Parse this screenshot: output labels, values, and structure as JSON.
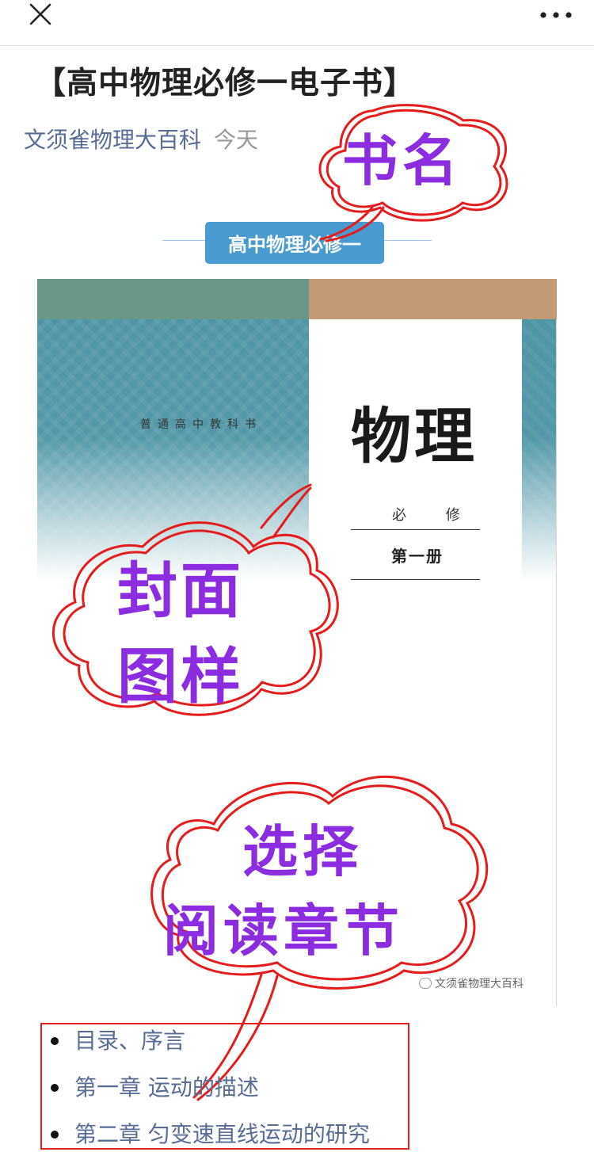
{
  "topbar": {
    "close_icon": "close-icon",
    "more_icon": "more-dots-icon"
  },
  "article": {
    "title": "【高中物理必修一电子书】",
    "author": "文须雀物理大百科",
    "date": "今天"
  },
  "book_section": {
    "label": "高中物理必修一"
  },
  "cover": {
    "series": "普通高中教科书",
    "subject": "物理",
    "required": "必 修",
    "volume": "第一册",
    "watermark": "文须雀物理大百科",
    "colors": {
      "top_left": "#6b9786",
      "top_right": "#c29a76",
      "pattern": "#4e95a5"
    }
  },
  "annotations": {
    "book_name": "书名",
    "cover_sample_line1": "封面",
    "cover_sample_line2": "图样",
    "choose_line1": "选择",
    "choose_line2": "阅读章节"
  },
  "toc": [
    {
      "label": "目录、序言"
    },
    {
      "label": "第一章 运动的描述"
    },
    {
      "label": "第二章 匀变速直线运动的研究"
    }
  ]
}
